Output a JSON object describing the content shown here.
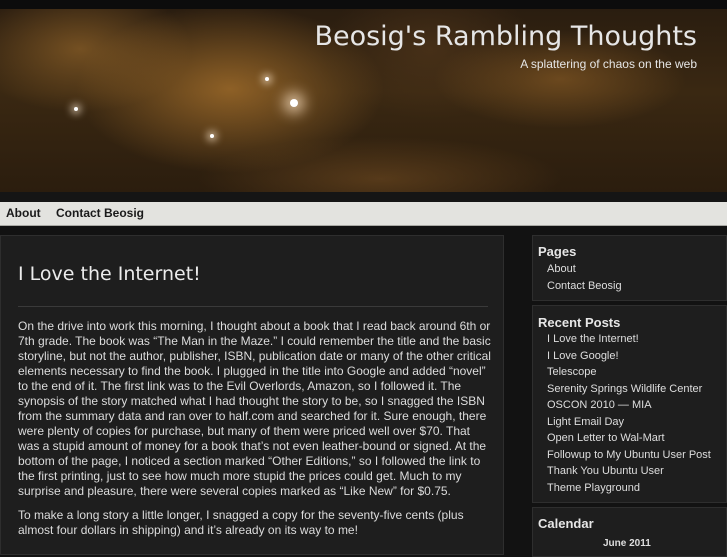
{
  "site": {
    "title": "Beosig's Rambling Thoughts",
    "tagline": "A splattering of chaos on the web"
  },
  "nav": {
    "items": [
      {
        "label": "About"
      },
      {
        "label": "Contact Beosig"
      }
    ]
  },
  "post": {
    "title": "I Love the Internet!",
    "paragraphs": [
      "On the drive into work this morning, I thought about a book that I read back around 6th or 7th grade. The book was “The Man in the Maze.” I could remember the title and the basic storyline, but not the author, publisher, ISBN, publication date or many of the other critical elements necessary to find the book. I plugged in the title into Google and added “novel” to the end of it. The first link was to the Evil Overlords, Amazon, so I followed it. The synopsis of the story matched what I had thought the story to be, so I snagged the ISBN from the summary data and ran over to half.com and searched for it. Sure enough, there were plenty of copies for purchase, but many of them were priced well over $70. That was a stupid amount of money for a book that’s not even leather-bound or signed. At the bottom of the page, I noticed a section marked “Other Editions,” so I followed the link to the first printing, just to see how much more stupid the prices could get. Much to my surprise and pleasure, there were several copies marked as “Like New” for $0.75.",
      "To make a long story a little longer, I snagged a copy for the seventy-five cents (plus almost four dollars in shipping) and it’s already on its way to me!"
    ]
  },
  "sidebar": {
    "pages": {
      "title": "Pages",
      "items": [
        "About",
        "Contact Beosig"
      ]
    },
    "recent_posts": {
      "title": "Recent Posts",
      "items": [
        "I Love the Internet!",
        "I Love Google!",
        "Telescope",
        "Serenity Springs Wildlife Center",
        "OSCON 2010 — MIA",
        "Light Email Day",
        "Open Letter to Wal-Mart",
        "Followup to My Ubuntu User Post",
        "Thank You Ubuntu User",
        "Theme Playground"
      ]
    },
    "calendar": {
      "title": "Calendar",
      "month": "June 2011"
    }
  },
  "colors": {
    "background": "#121212",
    "panel": "#1e1e1e",
    "navbar": "#e3e3df",
    "text": "#dcdcdc"
  }
}
